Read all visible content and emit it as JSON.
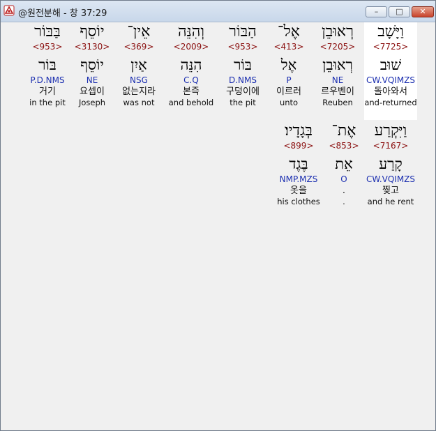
{
  "window": {
    "title": "@원전분해 - 창 37:29",
    "controls": {
      "minimize": "–",
      "maximize": "□",
      "close": "✕"
    }
  },
  "rows": [
    {
      "words": [
        {
          "hebrew": "וַיָּשָׁב",
          "strong": "<7725>",
          "root": "שׁוּב",
          "grammar": "CW.VQIMZS",
          "korean": "돌아와서",
          "english": "and-returned",
          "selected": true
        },
        {
          "hebrew": "רְאוּבֵן",
          "strong": "<7205>",
          "root": "רְאוּבֵן",
          "grammar": "NE",
          "korean": "르우벤이",
          "english": "Reuben"
        },
        {
          "hebrew": "אֶל־",
          "strong": "<413>",
          "root": "אֶל",
          "grammar": "P",
          "korean": "이르러",
          "english": "unto"
        },
        {
          "hebrew": "הַבּוֹר",
          "strong": "<953>",
          "root": "בּוֹר",
          "grammar": "D.NMS",
          "korean": "구덩이에",
          "english": "the pit"
        },
        {
          "hebrew": "וְהִנֵּה",
          "strong": "<2009>",
          "root": "הִנֵּה",
          "grammar": "C.Q",
          "korean": "본즉",
          "english": "and behold"
        },
        {
          "hebrew": "אֵין־",
          "strong": "<369>",
          "root": "אַיִן",
          "grammar": "NSG",
          "korean": "없는지라",
          "english": "was not"
        },
        {
          "hebrew": "יוֹסֵף",
          "strong": "<3130>",
          "root": "יוֹסֵף",
          "grammar": "NE",
          "korean": "요셉이",
          "english": "Joseph"
        },
        {
          "hebrew": "בַּבּוֹר",
          "strong": "<953>",
          "root": "בּוֹר",
          "grammar": "P.D.NMS",
          "korean": "거기",
          "english": "in the pit"
        }
      ]
    },
    {
      "words": [
        {
          "hebrew": "וַיִּקְרַע",
          "strong": "<7167>",
          "root": "קָרַע",
          "grammar": "CW.VQIMZS",
          "korean": "찢고",
          "english": "and he rent"
        },
        {
          "hebrew": "אֶת־",
          "strong": "<853>",
          "root": "אֵת",
          "grammar": "O",
          "korean": ".",
          "english": "."
        },
        {
          "hebrew": "בְּגָדָיו׃",
          "strong": "<899>",
          "root": "בֶּגֶד",
          "grammar": "NMP.MZS",
          "korean": "옷을",
          "english": "his clothes"
        }
      ]
    }
  ]
}
